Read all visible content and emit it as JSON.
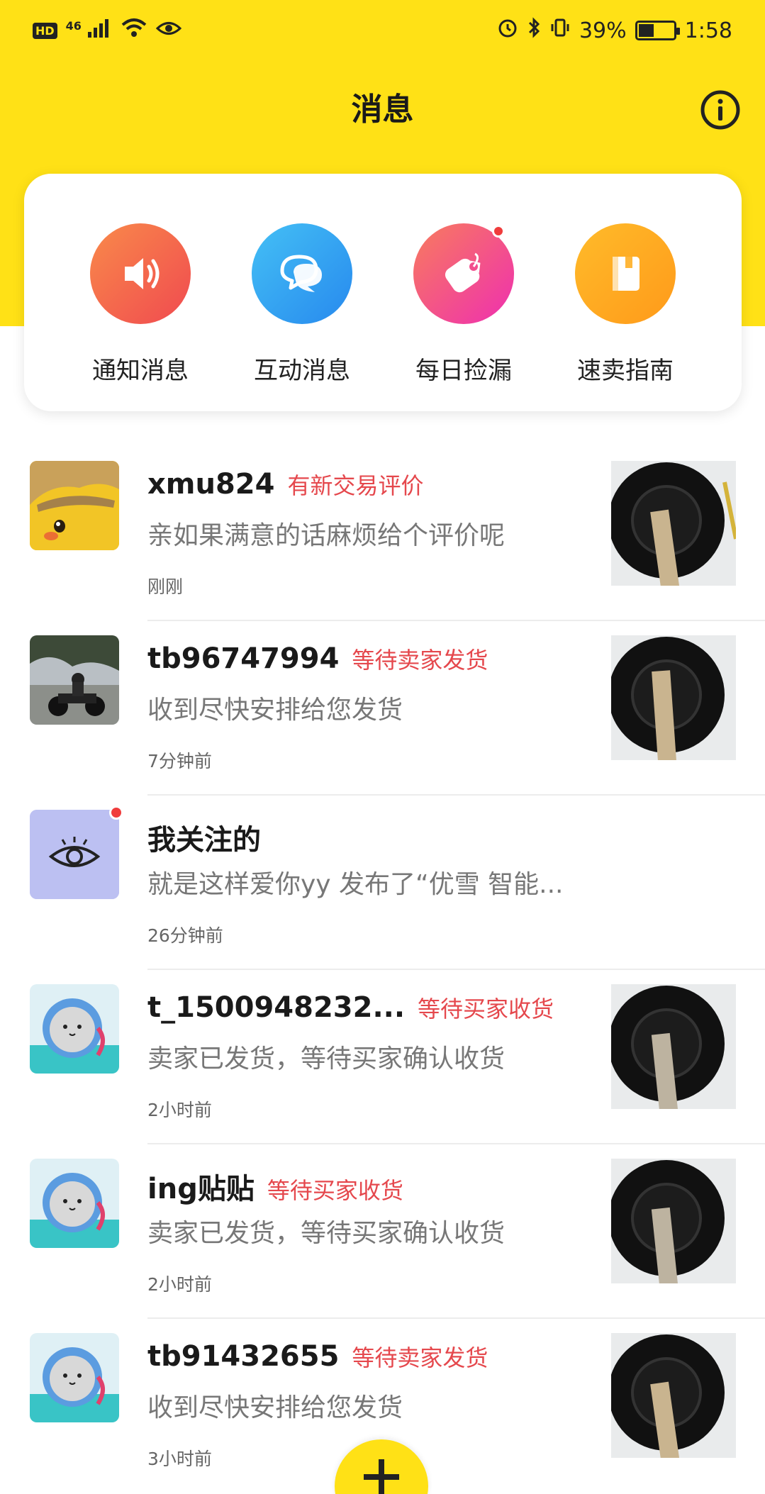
{
  "status_bar": {
    "hd": "HD",
    "network": "46",
    "battery": "39%",
    "time": "1:58"
  },
  "header": {
    "title": "消息",
    "info_icon": "info-icon"
  },
  "entries": [
    {
      "label": "通知消息",
      "icon": "speaker-icon",
      "color": "#f7624a"
    },
    {
      "label": "互动消息",
      "icon": "chat-bubbles-icon",
      "color": "#2fa6f2"
    },
    {
      "label": "每日捡漏",
      "icon": "tag-icon",
      "color": "#f23f97",
      "badge": true
    },
    {
      "label": "速卖指南",
      "icon": "book-icon",
      "color": "#ffa71f"
    }
  ],
  "messages": [
    {
      "name": "xmu824",
      "status": "有新交易评价",
      "preview": "亲如果满意的话麻烦给个评价呢",
      "time": "刚刚"
    },
    {
      "name": "tb96747994",
      "status": "等待卖家发货",
      "preview": "收到尽快安排给您发货",
      "time": "7分钟前"
    },
    {
      "name": "我关注的",
      "status": "",
      "preview": "就是这样爱你yy  发布了“优雪 智能...",
      "time": "26分钟前"
    },
    {
      "name": "t_1500948232...",
      "status": "等待买家收货",
      "preview": "卖家已发货，等待买家确认收货",
      "time": "2小时前"
    },
    {
      "name": "ing贴贴",
      "status": "等待买家收货",
      "preview": "卖家已发货，等待买家确认收货",
      "time": "2小时前"
    },
    {
      "name": "tb91432655",
      "status": "等待卖家发货",
      "preview": "收到尽快安排给您发货",
      "time": "3小时前"
    }
  ],
  "fab": {
    "icon": "plus-icon"
  }
}
